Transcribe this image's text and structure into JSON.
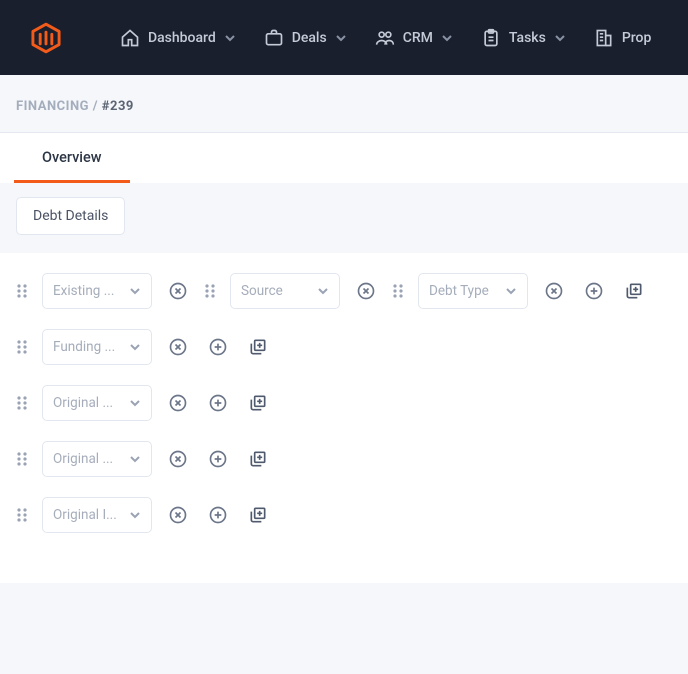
{
  "nav": {
    "items": [
      {
        "label": "Dashboard"
      },
      {
        "label": "Deals"
      },
      {
        "label": "CRM"
      },
      {
        "label": "Tasks"
      },
      {
        "label": "Prop"
      }
    ]
  },
  "breadcrumb": {
    "root": "FINANCING",
    "sep": " / ",
    "current": "#239"
  },
  "tabs": {
    "overview": "Overview"
  },
  "section": {
    "button": "Debt Details"
  },
  "row1": {
    "selects": [
      {
        "label": "Existing ..."
      },
      {
        "label": "Source"
      },
      {
        "label": "Debt Type"
      }
    ]
  },
  "rows_simple": [
    {
      "label": "Funding ..."
    },
    {
      "label": "Original ..."
    },
    {
      "label": "Original ..."
    },
    {
      "label": "Original I..."
    }
  ]
}
